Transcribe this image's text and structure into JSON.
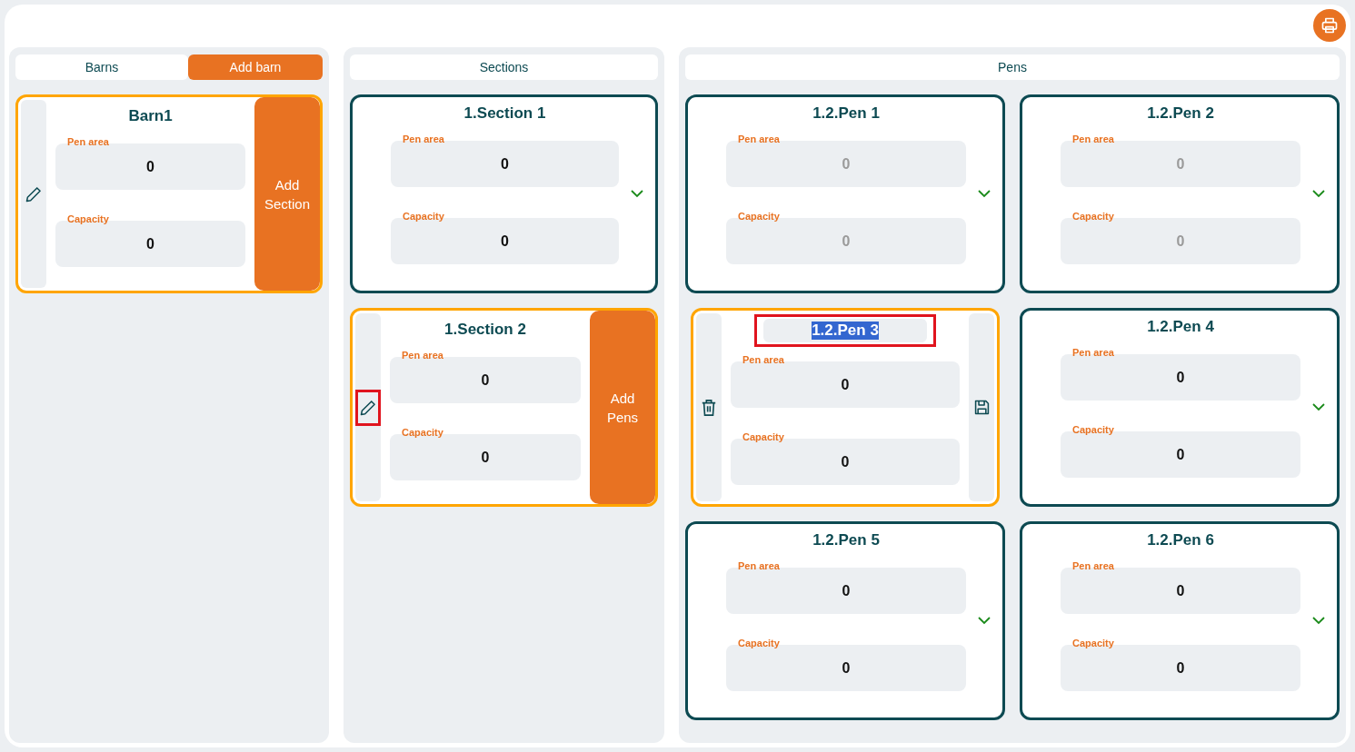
{
  "columns": [
    {
      "header": "Barns",
      "action": "Add barn",
      "cards": [
        {
          "kind": "active",
          "title": "Barn1",
          "action": "Add Section",
          "edit_highlighted": false,
          "fields": [
            {
              "label": "Pen area",
              "value": "0",
              "disabled": false
            },
            {
              "label": "Capacity",
              "value": "0",
              "disabled": false
            }
          ]
        }
      ]
    },
    {
      "header": "Sections",
      "cards": [
        {
          "kind": "collapsed",
          "title": "1.Section 1",
          "fields": [
            {
              "label": "Pen area",
              "value": "0",
              "disabled": false
            },
            {
              "label": "Capacity",
              "value": "0",
              "disabled": false
            }
          ]
        },
        {
          "kind": "active",
          "title": "1.Section 2",
          "action": "Add Pens",
          "edit_highlighted": true,
          "fields": [
            {
              "label": "Pen area",
              "value": "0",
              "disabled": false
            },
            {
              "label": "Capacity",
              "value": "0",
              "disabled": false
            }
          ]
        }
      ]
    },
    {
      "header": "Pens",
      "cards": [
        {
          "kind": "collapsed",
          "title": "1.2.Pen 1",
          "fields": [
            {
              "label": "Pen area",
              "value": "0",
              "disabled": true
            },
            {
              "label": "Capacity",
              "value": "0",
              "disabled": true
            }
          ]
        },
        {
          "kind": "collapsed",
          "title": "1.2.Pen 2",
          "fields": [
            {
              "label": "Pen area",
              "value": "0",
              "disabled": true
            },
            {
              "label": "Capacity",
              "value": "0",
              "disabled": true
            }
          ]
        },
        {
          "kind": "editing",
          "title": "1.2.Pen 3",
          "title_selected": true,
          "title_highlighted": true,
          "fields": [
            {
              "label": "Pen area",
              "value": "0",
              "disabled": false
            },
            {
              "label": "Capacity",
              "value": "0",
              "disabled": false
            }
          ]
        },
        {
          "kind": "collapsed",
          "title": "1.2.Pen 4",
          "fields": [
            {
              "label": "Pen area",
              "value": "0",
              "disabled": false
            },
            {
              "label": "Capacity",
              "value": "0",
              "disabled": false
            }
          ]
        },
        {
          "kind": "collapsed",
          "title": "1.2.Pen 5",
          "fields": [
            {
              "label": "Pen area",
              "value": "0",
              "disabled": false
            },
            {
              "label": "Capacity",
              "value": "0",
              "disabled": false
            }
          ]
        },
        {
          "kind": "collapsed",
          "title": "1.2.Pen 6",
          "fields": [
            {
              "label": "Pen area",
              "value": "0",
              "disabled": false
            },
            {
              "label": "Capacity",
              "value": "0",
              "disabled": false
            }
          ]
        }
      ]
    }
  ]
}
